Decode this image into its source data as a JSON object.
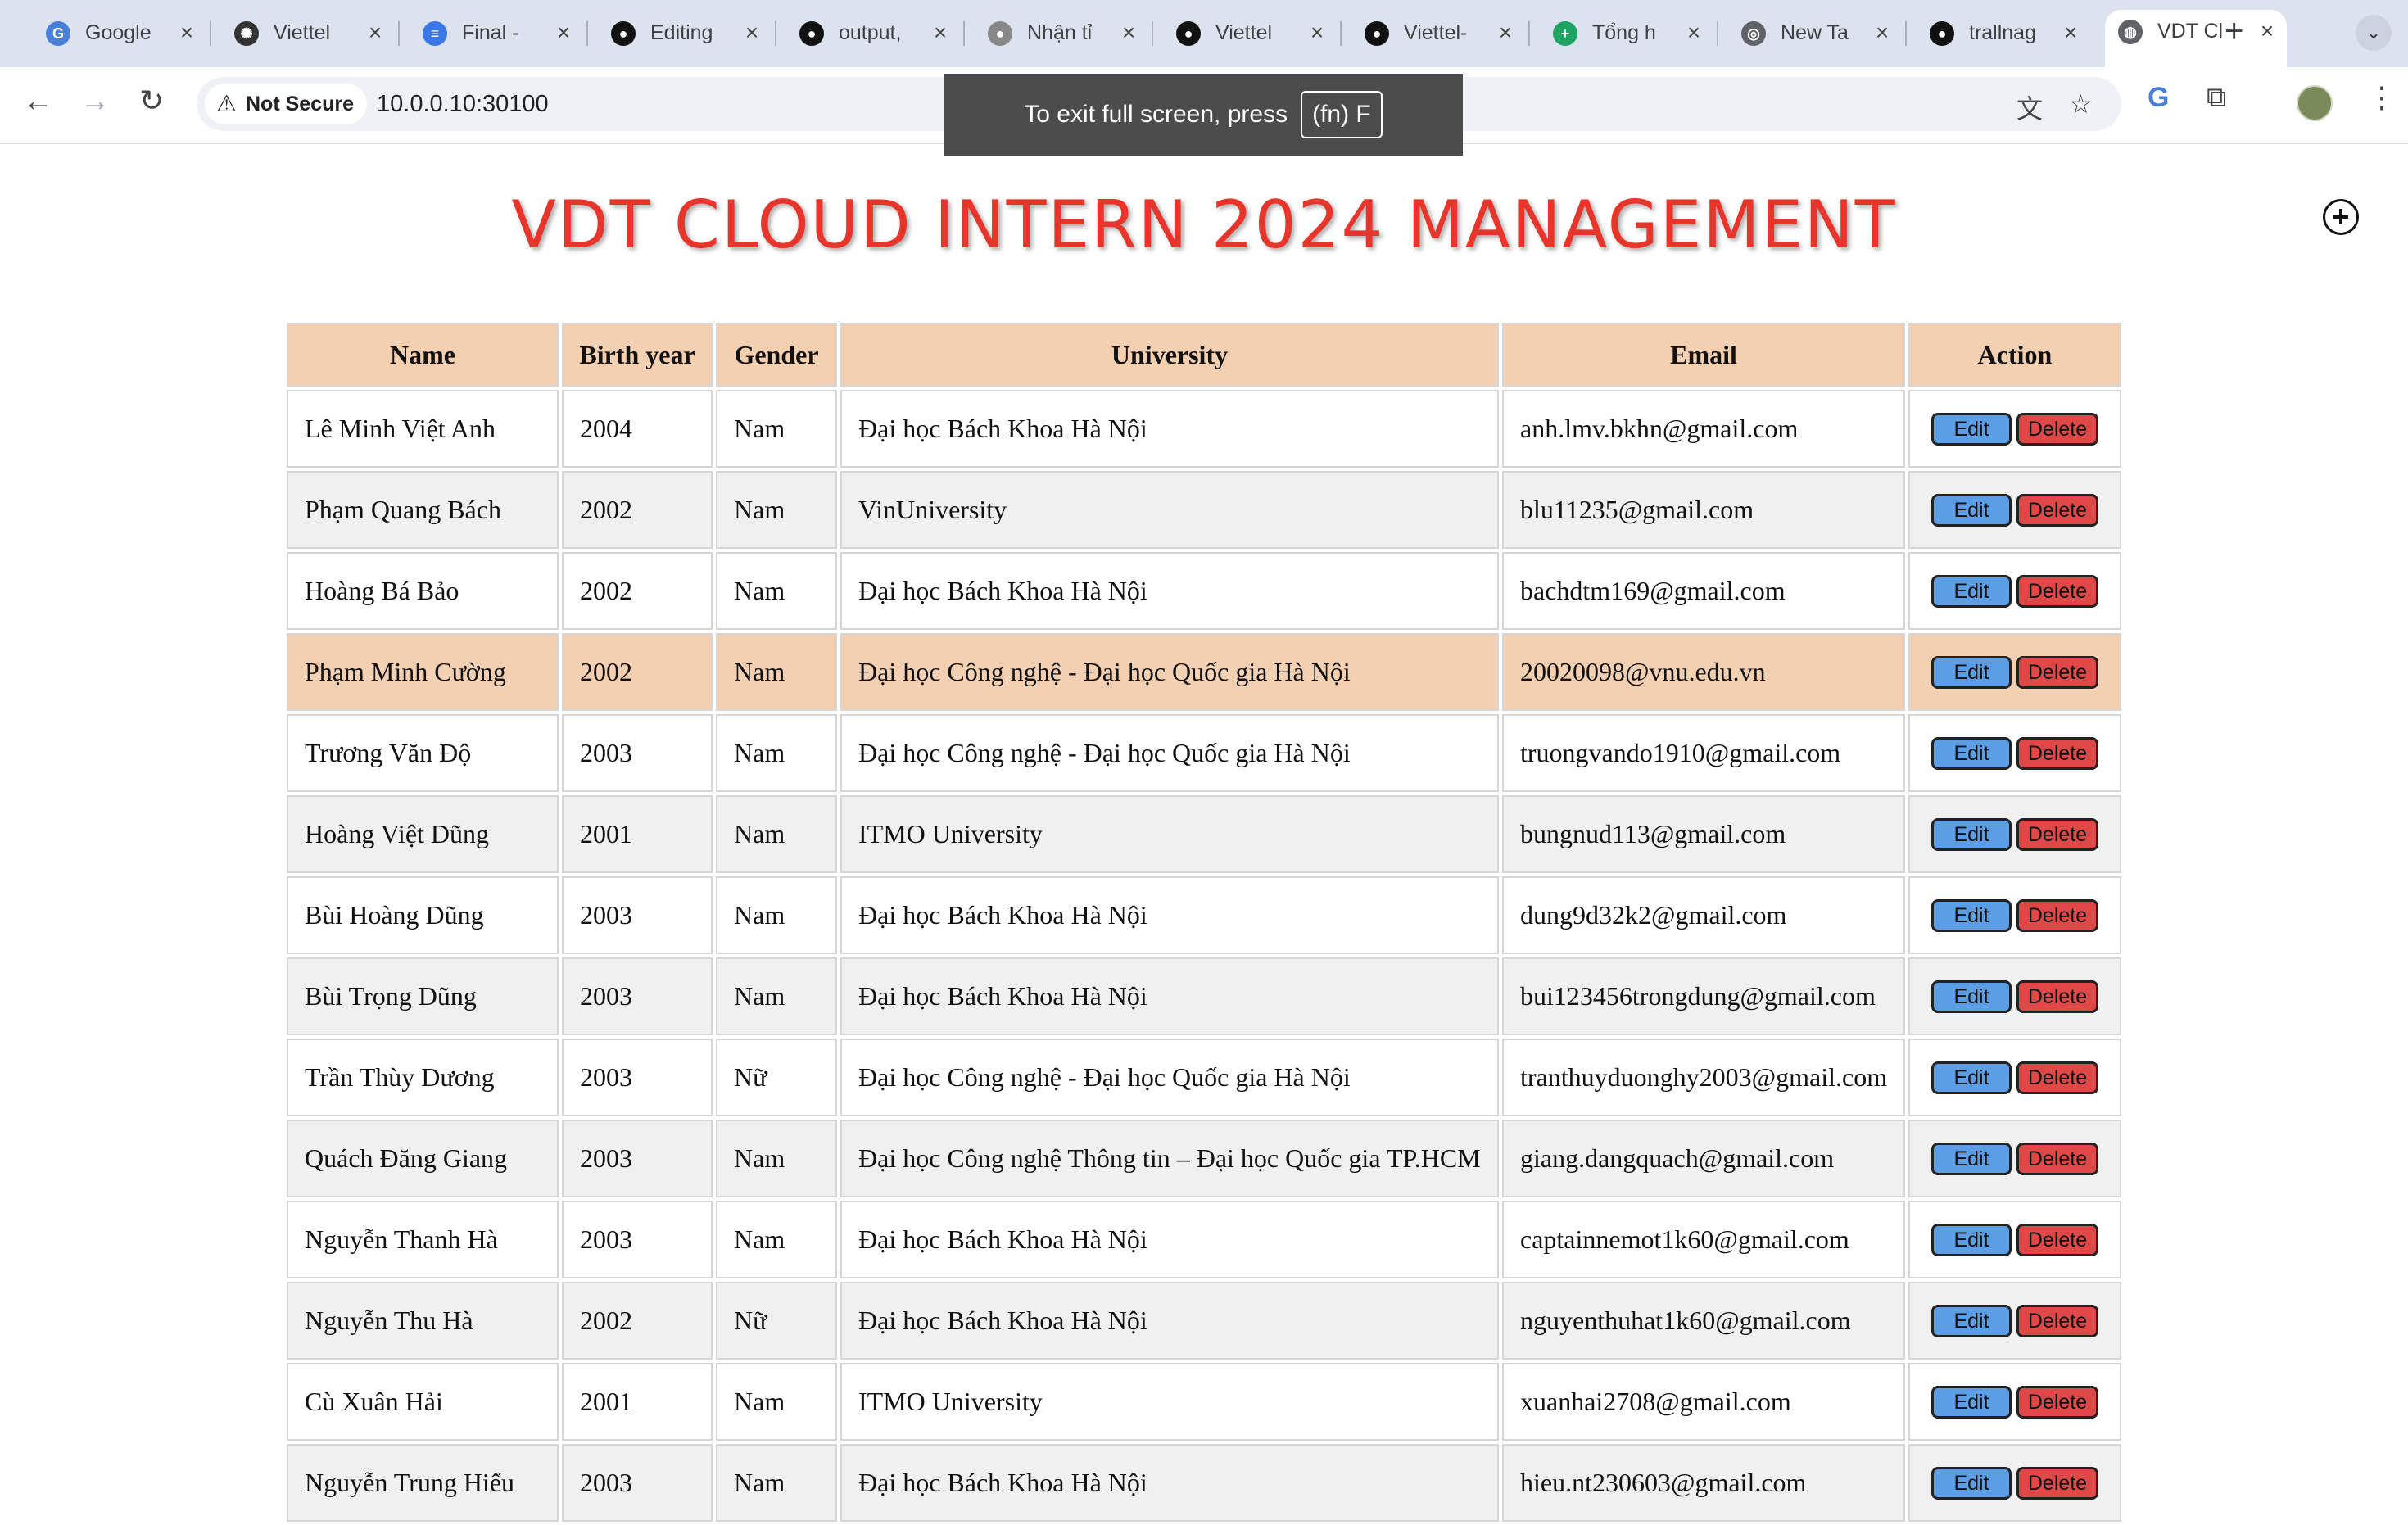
{
  "browser": {
    "tabs": [
      {
        "title": "Google",
        "icon": "google-translate-icon",
        "color": "#4a7fd8",
        "glyph": "G"
      },
      {
        "title": "Viettel",
        "icon": "chatgpt-icon",
        "color": "#333333",
        "glyph": "✺"
      },
      {
        "title": "Final -",
        "icon": "google-docs-icon",
        "color": "#3b78e7",
        "glyph": "≡"
      },
      {
        "title": "Editing",
        "icon": "github-icon",
        "color": "#111111",
        "glyph": "●"
      },
      {
        "title": "output,",
        "icon": "github-icon",
        "color": "#111111",
        "glyph": "●"
      },
      {
        "title": "Nhận tỉ",
        "icon": "apple-icon",
        "color": "#888888",
        "glyph": "●"
      },
      {
        "title": "Viettel",
        "icon": "github-icon",
        "color": "#111111",
        "glyph": "●"
      },
      {
        "title": "Viettel-",
        "icon": "github-icon",
        "color": "#111111",
        "glyph": "●"
      },
      {
        "title": "Tổng h",
        "icon": "google-sheets-icon",
        "color": "#1ea362",
        "glyph": "+"
      },
      {
        "title": "New Ta",
        "icon": "chrome-icon",
        "color": "#5f6368",
        "glyph": "◎"
      },
      {
        "title": "trallnag",
        "icon": "github-icon",
        "color": "#111111",
        "glyph": "●"
      },
      {
        "title": "VDT Cl",
        "icon": "globe-icon",
        "color": "#5f6368",
        "glyph": "◍",
        "active": true
      }
    ],
    "security_label": "Not Secure",
    "url": "10.0.0.10:30100",
    "fullscreen_toast": {
      "text": "To exit full screen, press",
      "key": "(fn) F"
    }
  },
  "page": {
    "title": "VDT CLOUD INTERN 2024 MANAGEMENT",
    "columns": [
      "Name",
      "Birth year",
      "Gender",
      "University",
      "Email",
      "Action"
    ],
    "edit_label": "Edit",
    "delete_label": "Delete",
    "highlighted_row": 3,
    "rows": [
      {
        "name": "Lê Minh Việt Anh",
        "year": "2004",
        "gender": "Nam",
        "university": "Đại học Bách Khoa Hà Nội",
        "email": "anh.lmv.bkhn@gmail.com"
      },
      {
        "name": "Phạm Quang Bách",
        "year": "2002",
        "gender": "Nam",
        "university": "VinUniversity",
        "email": "blu11235@gmail.com"
      },
      {
        "name": "Hoàng Bá Bảo",
        "year": "2002",
        "gender": "Nam",
        "university": "Đại học Bách Khoa Hà Nội",
        "email": "bachdtm169@gmail.com"
      },
      {
        "name": "Phạm Minh Cường",
        "year": "2002",
        "gender": "Nam",
        "university": "Đại học Công nghệ - Đại học Quốc gia Hà Nội",
        "email": "20020098@vnu.edu.vn"
      },
      {
        "name": "Trương Văn Độ",
        "year": "2003",
        "gender": "Nam",
        "university": "Đại học Công nghệ - Đại học Quốc gia Hà Nội",
        "email": "truongvando1910@gmail.com"
      },
      {
        "name": "Hoàng Việt Dũng",
        "year": "2001",
        "gender": "Nam",
        "university": "ITMO University",
        "email": "bungnud113@gmail.com"
      },
      {
        "name": "Bùi Hoàng Dũng",
        "year": "2003",
        "gender": "Nam",
        "university": "Đại học Bách Khoa Hà Nội",
        "email": "dung9d32k2@gmail.com"
      },
      {
        "name": "Bùi Trọng Dũng",
        "year": "2003",
        "gender": "Nam",
        "university": "Đại học Bách Khoa Hà Nội",
        "email": "bui123456trongdung@gmail.com"
      },
      {
        "name": "Trần Thùy Dương",
        "year": "2003",
        "gender": "Nữ",
        "university": "Đại học Công nghệ - Đại học Quốc gia Hà Nội",
        "email": "tranthuyduonghy2003@gmail.com"
      },
      {
        "name": "Quách Đăng Giang",
        "year": "2003",
        "gender": "Nam",
        "university": "Đại học Công nghệ Thông tin – Đại học Quốc gia TP.HCM",
        "email": "giang.dangquach@gmail.com"
      },
      {
        "name": "Nguyễn Thanh Hà",
        "year": "2003",
        "gender": "Nam",
        "university": "Đại học Bách Khoa Hà Nội",
        "email": "captainnemot1k60@gmail.com"
      },
      {
        "name": "Nguyễn Thu Hà",
        "year": "2002",
        "gender": "Nữ",
        "university": "Đại học Bách Khoa Hà Nội",
        "email": "nguyenthuhat1k60@gmail.com"
      },
      {
        "name": "Cù Xuân Hải",
        "year": "2001",
        "gender": "Nam",
        "university": "ITMO University",
        "email": "xuanhai2708@gmail.com"
      },
      {
        "name": "Nguyễn Trung Hiếu",
        "year": "2003",
        "gender": "Nam",
        "university": "Đại học Bách Khoa Hà Nội",
        "email": "hieu.nt230603@gmail.com"
      }
    ]
  }
}
